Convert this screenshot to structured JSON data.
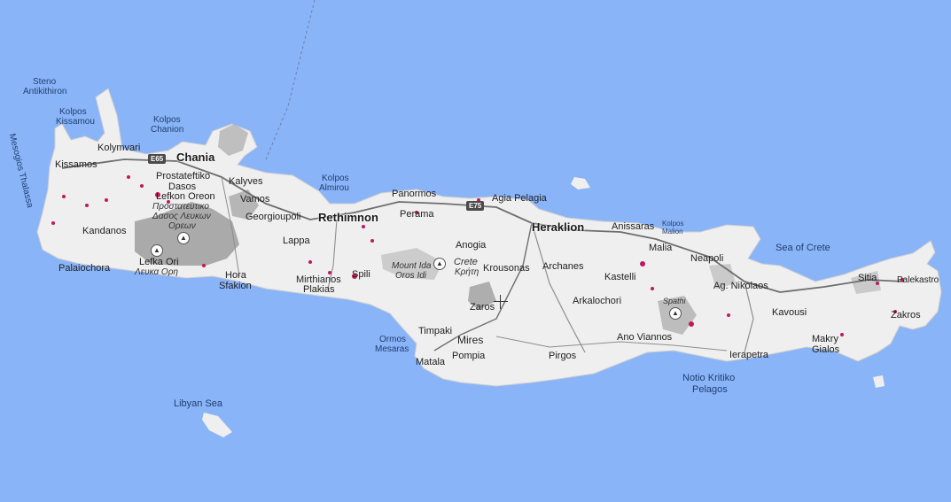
{
  "map": {
    "seas": {
      "steno_antikithiron_1": "Steno",
      "steno_antikithiron_2": "Antikithiron",
      "kolpos_kissamou_1": "Kolpos",
      "kolpos_kissamou_2": "Kissamou",
      "kolpos_chanion_1": "Kolpos",
      "kolpos_chanion_2": "Chanion",
      "mesogios_thalassa": "Mesogios Thalassa",
      "kolpos_almirou_1": "Kolpos",
      "kolpos_almirou_2": "Almirou",
      "kolpos_malion_1": "Kolpos",
      "kolpos_malion_2": "Malion",
      "sea_of_crete": "Sea of Crete",
      "ormos_mesaras_1": "Ormos",
      "ormos_mesaras_2": "Mesaras",
      "libyan_sea": "Libyan Sea",
      "notio_kritiko_1": "Notio Kritiko",
      "notio_kritiko_2": "Pelagos"
    },
    "cities": {
      "chania": "Chania",
      "rethimnon": "Rethimnon",
      "heraklion": "Heraklion"
    },
    "towns": {
      "kolymvari": "Kolymvari",
      "kissamos": "Kissamos",
      "prostateftiko": "Prostateftiko",
      "dasos": "Dasos",
      "lefkon_oreon": "Lefkon Oreon",
      "greek_forest_1": "Προστατευτικο",
      "greek_forest_2": "Δασος Λευκων",
      "greek_forest_3": "Ορεων",
      "kalyves": "Kalyves",
      "vamos": "Vamos",
      "georgioupoli": "Georgioupoli",
      "kandanos": "Kandanos",
      "lefka_ori": "Lefka Ori",
      "lefka_ori_greek": "Λευκα Ορη",
      "palaiochora": "Palaiochora",
      "hora_sfakion_1": "Hora",
      "hora_sfakion_2": "Sfakion",
      "lappa": "Lappa",
      "spili": "Spili",
      "mirthianos_1": "Mirthianos",
      "mirthianos_2": "Plakias",
      "panormos": "Panormos",
      "perama": "Perama",
      "agia_pelagia": "Agia Pelagia",
      "anogia": "Anogia",
      "mount_ida": "Mount Ida",
      "oros_idi": "Oros Idi",
      "crete": "Crete",
      "crete_greek": "Κρήτη",
      "krousonas": "Krousonas",
      "archanes": "Archanes",
      "zaros": "Zaros",
      "timpaki": "Timpaki",
      "mires": "Mires",
      "pompia": "Pompia",
      "matala": "Matala",
      "pirgos": "Pirgos",
      "arkalochori": "Arkalochori",
      "kastelli": "Kastelli",
      "anissaras": "Anissaras",
      "malia": "Malia",
      "spathi": "Spathi",
      "ano_viannos": "Ano Viannos",
      "neapoli": "Neapoli",
      "ag_nikolaos": "Ag. Nikolaos",
      "ierapetra": "Ierapetra",
      "kavousi": "Kavousi",
      "makry_1": "Makry",
      "makry_2": "Gialos",
      "sitia": "Sitia",
      "palekastro": "Palekastro",
      "zakros": "Zakros"
    },
    "roads": {
      "e65": "E65",
      "e75": "E75"
    },
    "colors": {
      "sea": "#8ab4f8",
      "land": "#efefef",
      "mountain": "#9e9e9e",
      "road": "#6e6e6e",
      "highlight": "#c2185b"
    }
  }
}
